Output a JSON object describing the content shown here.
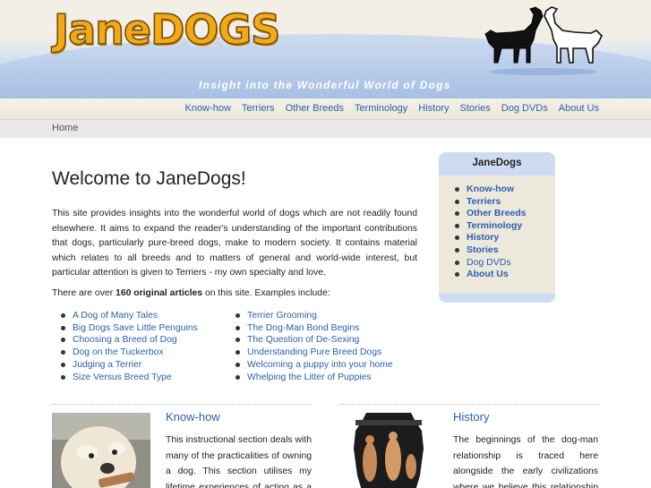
{
  "header": {
    "logo": "JaneDOGS",
    "tagline": "Insight into the Wonderful World of Dogs",
    "accent_color": "#f3a915"
  },
  "nav": {
    "items": [
      {
        "label": "Know-how"
      },
      {
        "label": "Terriers"
      },
      {
        "label": "Other Breeds"
      },
      {
        "label": "Terminology"
      },
      {
        "label": "History"
      },
      {
        "label": "Stories"
      },
      {
        "label": "Dog DVDs"
      },
      {
        "label": "About Us"
      }
    ]
  },
  "breadcrumb": {
    "home": "Home"
  },
  "main": {
    "title": "Welcome to JaneDogs!",
    "intro": "This site provides insights into the wonderful world of dogs which are not readily found elsewhere. It aims to expand the reader's understanding of the important contributions that dogs, particularly  pure-breed dogs, make to modern society.  It contains material which relates to all breeds and to matters of general and world-wide interest, but particular attention is given to Terriers - my own specialty and  love.",
    "count_prefix": "There are over ",
    "count_bold": "160 original articles",
    "count_suffix": " on this site. Examples include:",
    "articles_left": [
      "A Dog of Many Tales",
      "Big Dogs Save Little Penguins",
      "Choosing a Breed of Dog",
      "Dog on the Tuckerbox",
      "Judging a Terrier",
      "Size Versus Breed Type"
    ],
    "articles_right": [
      "Terrier Grooming",
      "The Dog-Man Bond Begins",
      "The Question of De-Sexing",
      "Understanding Pure Breed Dogs",
      "Welcoming a puppy into your home",
      "Whelping the Litter of Puppies"
    ]
  },
  "sidebar": {
    "title": "JaneDogs",
    "items": [
      {
        "label": "Know-how",
        "bold": true
      },
      {
        "label": "Terriers",
        "bold": true
      },
      {
        "label": "Other Breeds",
        "bold": true
      },
      {
        "label": "Terminology",
        "bold": true
      },
      {
        "label": "History",
        "bold": true
      },
      {
        "label": "Stories",
        "bold": true
      },
      {
        "label": "Dog DVDs",
        "bold": false
      },
      {
        "label": "About Us",
        "bold": true
      }
    ]
  },
  "features": [
    {
      "title": "Know-how",
      "text": "This instructional section deals with many of the practicalities of owning a dog. This section utilises my lifetime experiences of acting as a mentor to"
    },
    {
      "title": "History",
      "text": "The beginnings of the dog-man relationship is traced here alongside the early civilizations where we believe this relationship with the dog"
    }
  ]
}
